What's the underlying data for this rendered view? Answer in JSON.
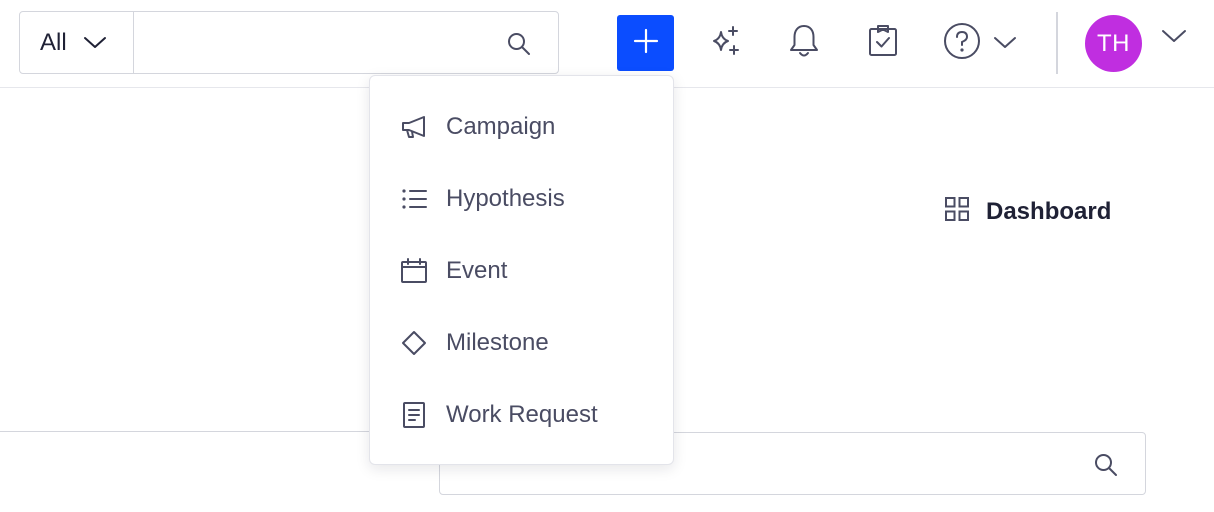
{
  "header": {
    "scope_select": {
      "label": "All"
    },
    "search": {
      "value": "",
      "placeholder": ""
    },
    "avatar_initials": "TH",
    "colors": {
      "add_button": "#0b4dff",
      "avatar": "#c02ee0"
    }
  },
  "add_menu": {
    "items": [
      {
        "label": "Campaign",
        "icon": "megaphone-icon"
      },
      {
        "label": "Hypothesis",
        "icon": "list-icon"
      },
      {
        "label": "Event",
        "icon": "calendar-icon"
      },
      {
        "label": "Milestone",
        "icon": "diamond-icon"
      },
      {
        "label": "Work Request",
        "icon": "document-icon"
      }
    ]
  },
  "main": {
    "dashboard_link": "Dashboard",
    "search": {
      "value": "",
      "placeholder": ""
    }
  }
}
